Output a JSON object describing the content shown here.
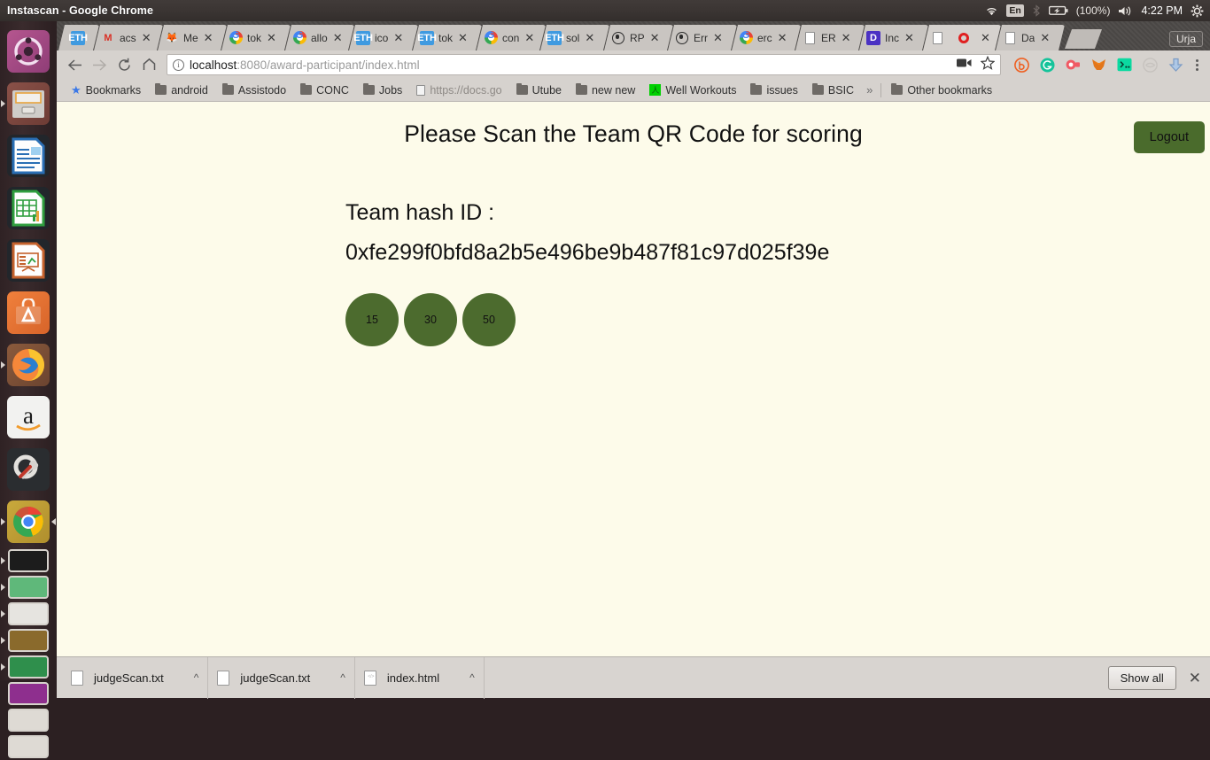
{
  "panel": {
    "window_title": "Instascan - Google Chrome",
    "tray": {
      "wifi_icon": "wifi-icon",
      "keyboard_layout": "En",
      "bluetooth_icon": "bluetooth-icon",
      "battery_icon": "battery-charging-icon",
      "battery_level": "(100%)",
      "volume_icon": "volume-icon",
      "clock": "4:22 PM",
      "session_icon": "system-settings-icon"
    }
  },
  "launcher": {
    "items": [
      {
        "name": "ubuntu-dash",
        "label": "Ubuntu Dash",
        "icon": "ubuntu-logo-icon"
      },
      {
        "name": "files",
        "label": "Files",
        "icon": "file-manager-icon"
      },
      {
        "name": "libreoffice-writer",
        "label": "LibreOffice Writer",
        "icon": "writer-icon"
      },
      {
        "name": "libreoffice-calc",
        "label": "LibreOffice Calc",
        "icon": "calc-icon"
      },
      {
        "name": "libreoffice-impress",
        "label": "LibreOffice Impress",
        "icon": "impress-icon"
      },
      {
        "name": "ubuntu-software",
        "label": "Ubuntu Software",
        "icon": "software-center-icon"
      },
      {
        "name": "firefox",
        "label": "Firefox",
        "icon": "firefox-icon"
      },
      {
        "name": "amazon",
        "label": "Amazon",
        "icon": "amazon-icon"
      },
      {
        "name": "system-settings",
        "label": "System Settings",
        "icon": "gear-wrench-icon"
      },
      {
        "name": "google-chrome",
        "label": "Google Chrome",
        "icon": "chrome-icon"
      }
    ]
  },
  "chrome": {
    "tabs": [
      {
        "title": "",
        "favicon": "eth",
        "active": false
      },
      {
        "title": "acs",
        "favicon": "gmail",
        "active": false
      },
      {
        "title": "Me",
        "favicon": "fox",
        "active": false
      },
      {
        "title": "tok",
        "favicon": "google",
        "active": false
      },
      {
        "title": "allo",
        "favicon": "google",
        "active": false
      },
      {
        "title": "ico",
        "favicon": "eth",
        "active": false
      },
      {
        "title": "tok",
        "favicon": "eth",
        "active": false
      },
      {
        "title": "con",
        "favicon": "google",
        "active": false
      },
      {
        "title": "sol",
        "favicon": "eth",
        "active": false
      },
      {
        "title": "RP",
        "favicon": "github",
        "active": false
      },
      {
        "title": "Err",
        "favicon": "github",
        "active": false
      },
      {
        "title": "erc",
        "favicon": "google",
        "active": false
      },
      {
        "title": "ER",
        "favicon": "doc",
        "active": false
      },
      {
        "title": "Inc",
        "favicon": "disc",
        "active": false
      },
      {
        "title": "",
        "favicon": "rec",
        "active": true
      },
      {
        "title": "Da",
        "favicon": "doc",
        "active": false
      }
    ],
    "user_chip": "Urja",
    "toolbar": {
      "back_icon": "back-arrow-icon",
      "forward_icon": "forward-arrow-icon",
      "reload_icon": "reload-icon",
      "home_icon": "home-icon",
      "site_info_icon": "info-circle-icon",
      "url_host": "localhost",
      "url_path": ":8080/award-participant/index.html",
      "url_full": "localhost:8080/award-participant/index.html",
      "cast_icon": "video-camera-icon",
      "bookmark_star_icon": "star-outline-icon",
      "extensions": [
        "bitly-extension-icon",
        "grammarly-extension-icon",
        "clipboard-extension-icon",
        "metamask-extension-icon",
        "terminal-extension-icon",
        "eye-extension-icon",
        "download-extension-icon"
      ],
      "menu_icon": "three-dot-menu-icon"
    },
    "bookmarks": [
      {
        "label": "Bookmarks",
        "icon": "star-icon"
      },
      {
        "label": "android",
        "icon": "folder-icon"
      },
      {
        "label": "Assistodo",
        "icon": "folder-icon"
      },
      {
        "label": "CONC",
        "icon": "folder-icon"
      },
      {
        "label": "Jobs",
        "icon": "folder-icon"
      },
      {
        "label": "https://docs.go",
        "icon": "page-icon"
      },
      {
        "label": "Utube",
        "icon": "folder-icon"
      },
      {
        "label": "new new",
        "icon": "folder-icon"
      },
      {
        "label": "Well Workouts",
        "icon": "green-site-icon"
      },
      {
        "label": "issues",
        "icon": "folder-icon"
      },
      {
        "label": "BSIC",
        "icon": "folder-icon"
      }
    ],
    "bookmarks_overflow": "»",
    "other_bookmarks": {
      "label": "Other bookmarks",
      "icon": "folder-icon"
    }
  },
  "page": {
    "heading": "Please Scan the Team QR Code for scoring",
    "logout_label": "Logout",
    "team_hash_label": "Team hash ID :",
    "team_hash_value": "0xfe299f0bfd8a2b5e496be9b487f81c97d025f39e",
    "scores": [
      "15",
      "30",
      "50"
    ],
    "colors": {
      "background": "#fdfbea",
      "accent_green": "#4c6b2e",
      "logout_green": "#4a6b2c",
      "text": "#111111"
    }
  },
  "downloads": {
    "items": [
      {
        "name": "judgeScan.txt",
        "icon": "text-file-icon",
        "caret": "^"
      },
      {
        "name": "judgeScan.txt",
        "icon": "text-file-icon",
        "caret": "^"
      },
      {
        "name": "index.html",
        "icon": "html-file-icon",
        "caret": "^"
      }
    ],
    "show_all_label": "Show all",
    "close_label": "✕"
  }
}
